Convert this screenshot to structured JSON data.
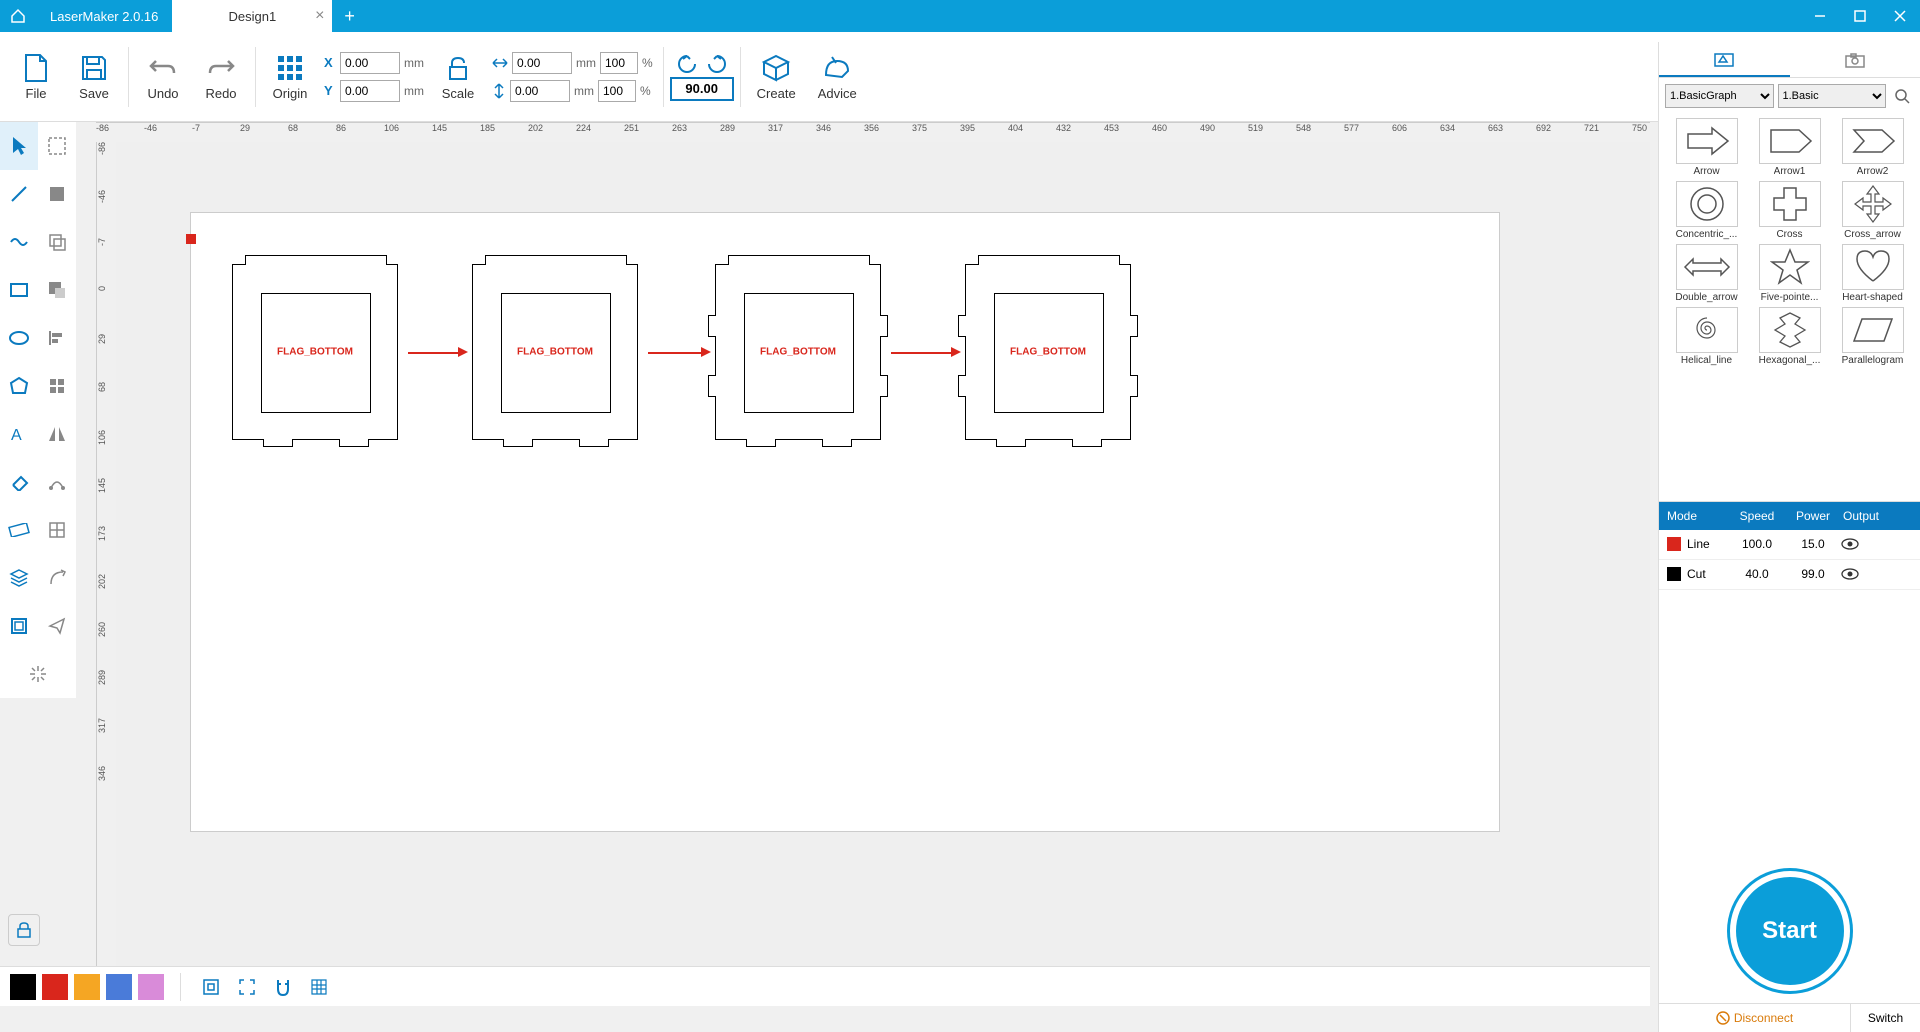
{
  "app_title": "LaserMaker 2.0.16",
  "tab": {
    "name": "Design1"
  },
  "toolbar": {
    "file": "File",
    "save": "Save",
    "undo": "Undo",
    "redo": "Redo",
    "origin": "Origin",
    "scale": "Scale",
    "create": "Create",
    "advice": "Advice",
    "x": "0.00",
    "y": "0.00",
    "w": "0.00",
    "h": "0.00",
    "sx": "100",
    "sy": "100",
    "angle": "90.00",
    "unit_mm": "mm",
    "unit_pct": "%",
    "x_label": "X",
    "y_label": "Y"
  },
  "ruler_h": [
    "-86",
    "-46",
    "-7",
    "29",
    "68",
    "86",
    "106",
    "145",
    "185",
    "202",
    "224",
    "251",
    "263",
    "289",
    "317",
    "346",
    "356",
    "375",
    "395",
    "404",
    "432",
    "453",
    "460",
    "490",
    "519",
    "548",
    "577",
    "606",
    "634",
    "663",
    "692",
    "721",
    "750"
  ],
  "ruler_v": [
    "-86",
    "-46",
    "-7",
    "0",
    "29",
    "68",
    "106",
    "145",
    "173",
    "202",
    "260",
    "289",
    "317",
    "346"
  ],
  "canvas": {
    "piece_label": "FLAG_BOTTOM"
  },
  "shapes_filter1": "1.BasicGraph",
  "shapes_filter2": "1.Basic",
  "shapes": [
    {
      "name": "Arrow"
    },
    {
      "name": "Arrow1"
    },
    {
      "name": "Arrow2"
    },
    {
      "name": "Concentric_..."
    },
    {
      "name": "Cross"
    },
    {
      "name": "Cross_arrow"
    },
    {
      "name": "Double_arrow"
    },
    {
      "name": "Five-pointe..."
    },
    {
      "name": "Heart-shaped"
    },
    {
      "name": "Helical_line"
    },
    {
      "name": "Hexagonal_..."
    },
    {
      "name": "Parallelogram"
    }
  ],
  "layers": {
    "head": {
      "mode": "Mode",
      "speed": "Speed",
      "power": "Power",
      "output": "Output"
    },
    "rows": [
      {
        "color": "#d9261c",
        "mode": "Line",
        "speed": "100.0",
        "power": "15.0"
      },
      {
        "color": "#000000",
        "mode": "Cut",
        "speed": "40.0",
        "power": "99.0"
      }
    ]
  },
  "start": "Start",
  "connection": {
    "status": "Disconnect",
    "switch": "Switch"
  },
  "palette": [
    "#000000",
    "#d9261c",
    "#f5a623",
    "#4a7bd9",
    "#d98bd9"
  ]
}
